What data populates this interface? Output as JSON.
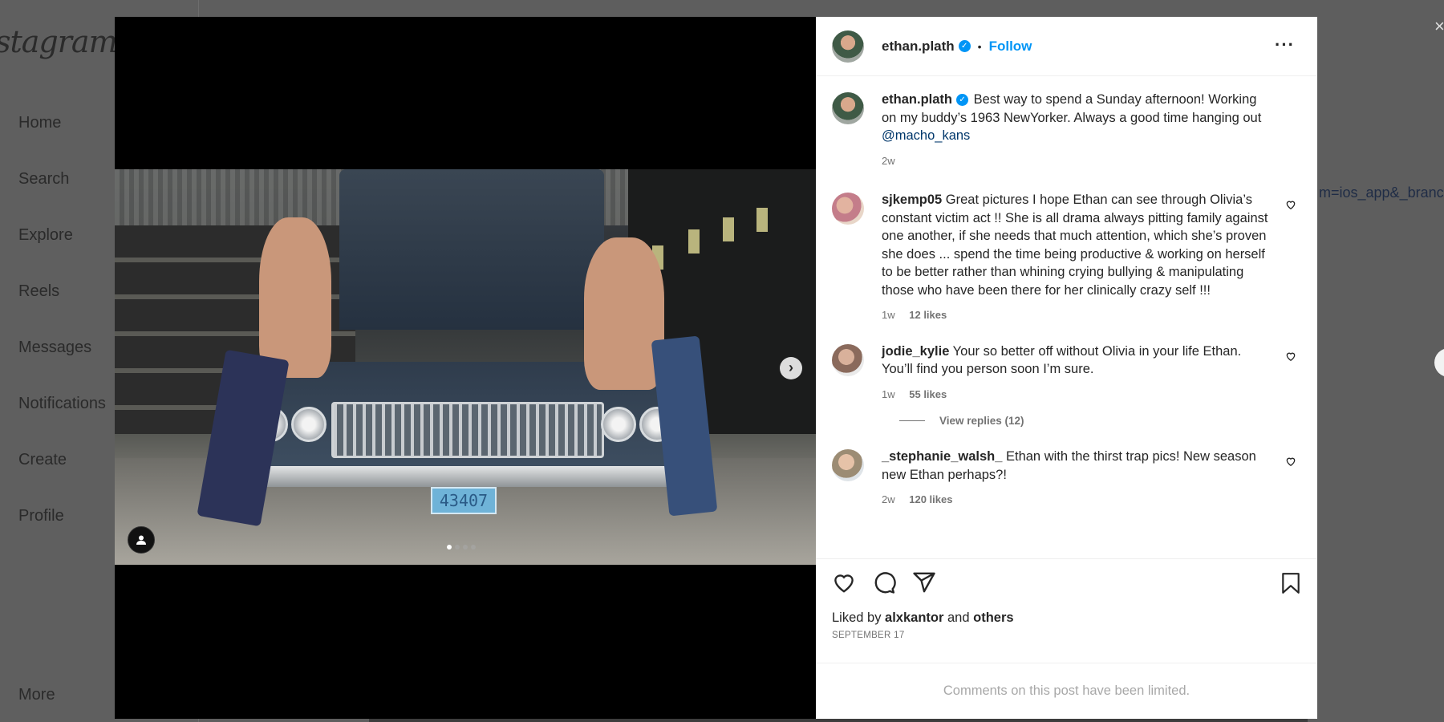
{
  "background": {
    "logo_text": "stagram",
    "nav": [
      "Home",
      "Search",
      "Explore",
      "Reels",
      "Messages",
      "Notifications",
      "Create",
      "Profile",
      "More"
    ],
    "url_fragment": "m=ios_app&_branch",
    "close_glyph": "×"
  },
  "media": {
    "plate_text": "43407",
    "next_icon": "chevron-right-icon",
    "tag_icon": "user-tag-icon",
    "carousel_total": 4,
    "carousel_index": 0
  },
  "post": {
    "author": "ethan.plath",
    "follow_label": "Follow",
    "separator": "•",
    "more_label": "···",
    "caption": {
      "user": "ethan.plath",
      "text": " Best way to spend a Sunday afternoon! Working on my buddy’s 1963 NewYorker. Always a good time hanging out ",
      "mention": "@macho_kans",
      "time": "2w"
    },
    "comments": [
      {
        "user": "sjkemp05",
        "text": " Great pictures I hope Ethan can see through Olivia’s constant victim act !! She is all drama always pitting family against one another, if she needs that much attention, which she’s proven she does ... spend the time being productive & working on herself to be better rather than whining crying bullying & manipulating those who have been there for her clinically crazy self !!!",
        "time": "1w",
        "likes": "12 likes"
      },
      {
        "user": "jodie_kylie",
        "text": " Your so better off without Olivia in your life Ethan. You’ll find you person soon I’m sure.",
        "time": "1w",
        "likes": "55 likes",
        "replies": "View replies (12)"
      },
      {
        "user": "_stephanie_walsh_",
        "text": " Ethan with the thirst trap pics! New season new Ethan perhaps?!",
        "time": "2w",
        "likes": "120 likes"
      }
    ],
    "liked_by_prefix": "Liked by ",
    "liked_by_user": "alxkantor",
    "liked_by_and": " and ",
    "liked_by_others": "others",
    "date": "SEPTEMBER 17",
    "limited_notice": "Comments on this post have been limited."
  },
  "colors": {
    "accent": "#0095f6",
    "mention": "#00376b",
    "muted": "#737373"
  }
}
